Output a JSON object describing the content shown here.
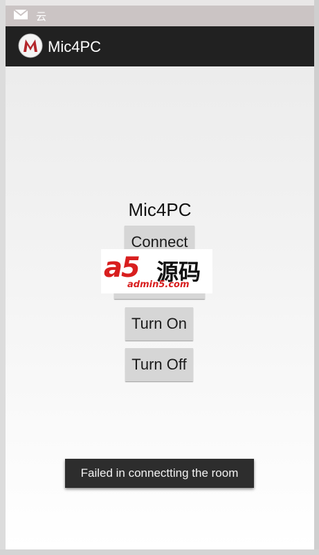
{
  "status_bar": {
    "notification_icon": "mail-icon",
    "text": "云"
  },
  "action_bar": {
    "logo_icon": "app-logo-m",
    "title": "Mic4PC"
  },
  "main": {
    "heading": "Mic4PC",
    "buttons": {
      "connect": "Connect",
      "turn_on": "Turn On",
      "turn_off": "Turn Off"
    }
  },
  "watermark": {
    "brand": "a5",
    "chinese": "源码",
    "url": "admin5.com"
  },
  "toast": {
    "message": "Failed in connectting the room"
  },
  "colors": {
    "status_bar": "#cbc4c4",
    "action_bar": "#212121",
    "button": "#d6d6d6",
    "toast": "#2d2d2d",
    "watermark_red": "#d81e1e"
  }
}
